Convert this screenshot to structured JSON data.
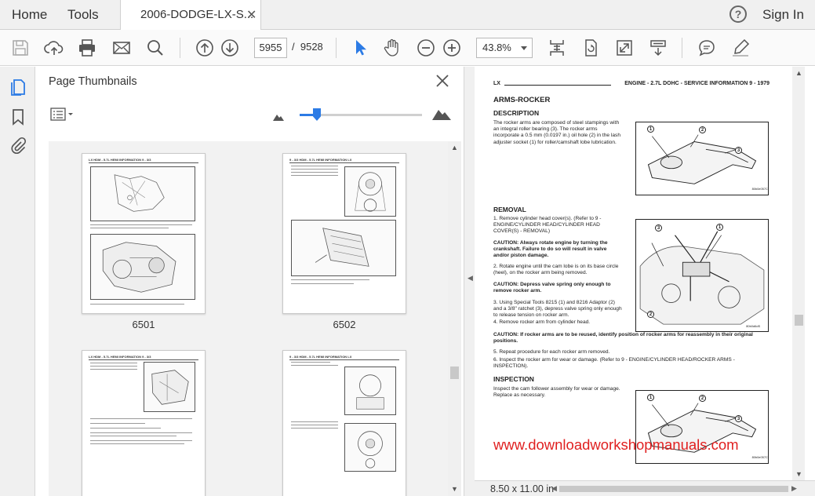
{
  "menu": {
    "home": "Home",
    "tools": "Tools"
  },
  "tab": {
    "title": "2006-DODGE-LX-S...",
    "close": "✕"
  },
  "header_right": {
    "help": "?",
    "signin": "Sign In"
  },
  "toolbar": {
    "page_current": "5955",
    "page_separator": "/",
    "page_total": "9528",
    "zoom": "43.8%"
  },
  "thumbnails_panel": {
    "title": "Page Thumbnails",
    "zoom_level_fraction": 0.14,
    "thumbnails": [
      {
        "page": "6501",
        "header": "LX                 HDM - 5.7L HEMI INFORMATION              9 - 3/3"
      },
      {
        "page": "6502",
        "header": "9 - 3/3     HDM - 5.7L HEMI INFORMATION                           LX"
      },
      {
        "page": "",
        "header": "LX                 HDM - 5.7L HEMI INFORMATION              9 - 3/3"
      },
      {
        "page": "",
        "header": "9 - 3/3     HDM - 5.7L HEMI INFORMATION                           LX"
      }
    ]
  },
  "document": {
    "header_left": "LX",
    "header_right": "ENGINE - 2.7L DOHC - SERVICE INFORMATION     9 - 1979",
    "title": "ARMS-ROCKER",
    "description_heading": "DESCRIPTION",
    "description_text": "The rocker arms are composed of steel stampings with an integral roller bearing (3). The rocker arms incorporate a 0.5 mm (0.0197 in.) oil hole (2) in the lash adjuster socket (1) for roller/camshaft lobe lubrication.",
    "removal_heading": "REMOVAL",
    "removal_step1": "1. Remove cylinder head cover(s). (Refer to 9 - ENGINE/CYLINDER HEAD/CYLINDER HEAD COVER(S) - REMOVAL)",
    "caution1": "CAUTION: Always rotate engine by turning the crankshaft. Failure to do so will result in valve and/or piston damage.",
    "removal_step2": "2. Rotate engine until the cam lobe is on its base circle (heel), on the rocker arm being removed.",
    "caution2": "CAUTION: Depress valve spring only enough to remove rocker arm.",
    "removal_step3": "3. Using Special Tools 8215 (1) and 8216 Adaptor (2) and a 3/8\" ratchet (3), depress valve spring only enough to release tension on rocker arm.",
    "removal_step4": "4. Remove rocker arm from cylinder head.",
    "caution3": "CAUTION: If rocker arms are to be reused, identify position of rocker arms for reassembly in their original positions.",
    "removal_step5": "5. Repeat procedure for each rocker arm removed.",
    "removal_step6": "6. Inspect the rocker arm for wear or damage. (Refer to 9 - ENGINE/CYLINDER HEAD/ROCKER ARMS - INSPECTION).",
    "inspection_heading": "INSPECTION",
    "inspection_text": "Inspect the cam follower assembly for wear or damage. Replace as necessary.",
    "fig1_code": "80b0e057C",
    "fig2_code": "80b0d6dS",
    "fig3_code": "80b0e057C",
    "callouts": [
      "1",
      "2",
      "3"
    ],
    "watermark": "www.downloadworkshopmanuals.com"
  },
  "statusbar": {
    "page_size": "8.50 x 11.00 in"
  },
  "icons": {
    "toolbar": [
      "save-icon",
      "cloud-upload-icon",
      "print-icon",
      "email-icon",
      "search-icon",
      "prev-page-icon",
      "next-page-icon",
      "select-cursor-icon",
      "hand-icon",
      "zoom-out-icon",
      "zoom-in-icon",
      "fit-page-icon",
      "rotate-icon",
      "fullscreen-icon",
      "scroll-mode-icon",
      "comment-icon",
      "highlight-icon"
    ],
    "rail": [
      "thumbnails-icon",
      "bookmark-icon",
      "attachment-icon"
    ]
  },
  "colors": {
    "accent": "#2c7be5",
    "watermark": "#e02020"
  }
}
